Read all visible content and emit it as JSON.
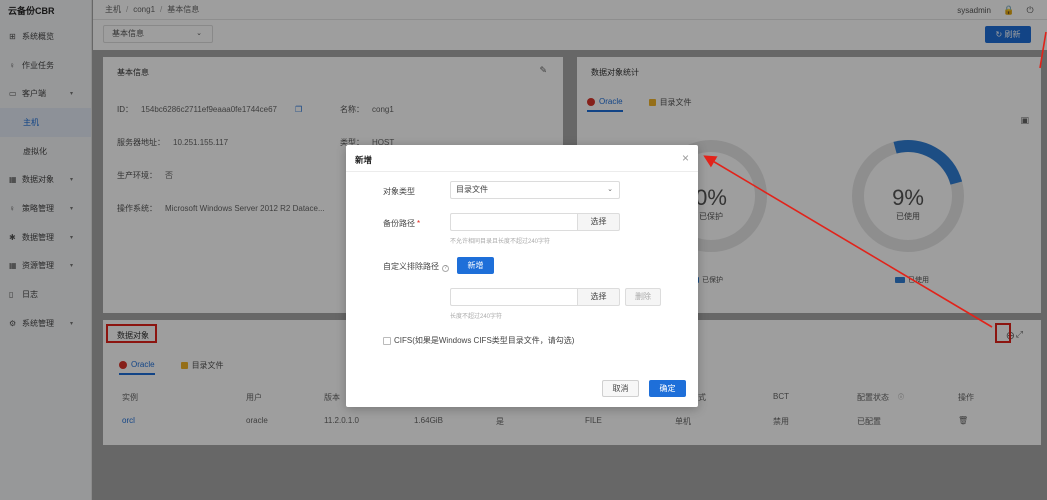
{
  "brand": "云备份CBR",
  "sidebar": {
    "items": [
      {
        "label": "系统概览",
        "icon": "⊞",
        "caret": ""
      },
      {
        "label": "作业任务",
        "icon": "♀",
        "caret": ""
      },
      {
        "label": "客户端",
        "icon": "▭",
        "caret": "▾"
      },
      {
        "label": "主机",
        "icon": "",
        "caret": ""
      },
      {
        "label": "虚拟化",
        "icon": "",
        "caret": ""
      },
      {
        "label": "数据对象",
        "icon": "▦",
        "caret": "▾"
      },
      {
        "label": "策略管理",
        "icon": "♀",
        "caret": "▾"
      },
      {
        "label": "数据管理",
        "icon": "✱",
        "caret": "▾"
      },
      {
        "label": "资源管理",
        "icon": "▦",
        "caret": "▾"
      },
      {
        "label": "日志",
        "icon": "▯",
        "caret": ""
      },
      {
        "label": "系统管理",
        "icon": "⚙",
        "caret": "▾"
      }
    ]
  },
  "breadcrumb": [
    "主机",
    "cong1",
    "基本信息"
  ],
  "header": {
    "user": "sysadmin",
    "lock_icon": "🔒",
    "power_icon": "⏻"
  },
  "subbar": {
    "select_value": "基本信息",
    "refresh_label": "刷新",
    "refresh_icon": "↻"
  },
  "basic_info": {
    "title": "基本信息",
    "id_label": "ID：",
    "id_value": "154bc6286c2711ef9eaaa0fe1744ce67",
    "name_label": "名称：",
    "name_value": "cong1",
    "server_label": "服务器地址：",
    "server_value": "10.251.155.117",
    "type_label": "类型：",
    "type_value": "HOST",
    "env_label": "生产环境：",
    "env_value": "否",
    "os_label": "操作系统：",
    "os_value": "Microsoft Windows Server 2012 R2 Datace..."
  },
  "stats": {
    "title": "数据对象统计",
    "tabs": [
      "Oracle",
      "目录文件"
    ],
    "ring1": {
      "pct": "0%",
      "label": "已保护",
      "legend": "已保护"
    },
    "ring2": {
      "pct": "9%",
      "label": "已使用",
      "legend": "已使用",
      "fraction": 0.09
    }
  },
  "objects": {
    "title": "数据对象",
    "tabs": [
      "Oracle",
      "目录文件"
    ],
    "columns": [
      "实例",
      "用户",
      "版本",
      "",
      "",
      "",
      "",
      "BCT",
      "配置状态",
      "操作"
    ],
    "rows": [
      {
        "instance": "orcl",
        "user": "oracle",
        "version": "11.2.0.1.0",
        "size": "1.64GiB",
        "flag": "是",
        "mode": "FILE",
        "deploy": "单机",
        "bct": "禁用",
        "status": "已配置"
      }
    ],
    "col_fragment": "式"
  },
  "modal": {
    "title": "新增",
    "object_type_label": "对象类型",
    "object_type_value": "目录文件",
    "backup_path_label": "备份路径",
    "backup_path_required": "*",
    "choose_label": "选择",
    "backup_hint": "不允许相同目录且长度不超过240字符",
    "exclude_label": "自定义排除路径",
    "add_label": "新增",
    "delete_label": "删除",
    "exclude_hint": "长度不超过240字符",
    "cifs_label": "CIFS(如果是Windows CIFS类型目录文件，请勾选)",
    "cancel_label": "取消",
    "confirm_label": "确定"
  },
  "colors": {
    "accent": "#1e6fd9",
    "annotation": "#e2231a",
    "oracle": "#d9342b",
    "folder": "#f0b429"
  }
}
